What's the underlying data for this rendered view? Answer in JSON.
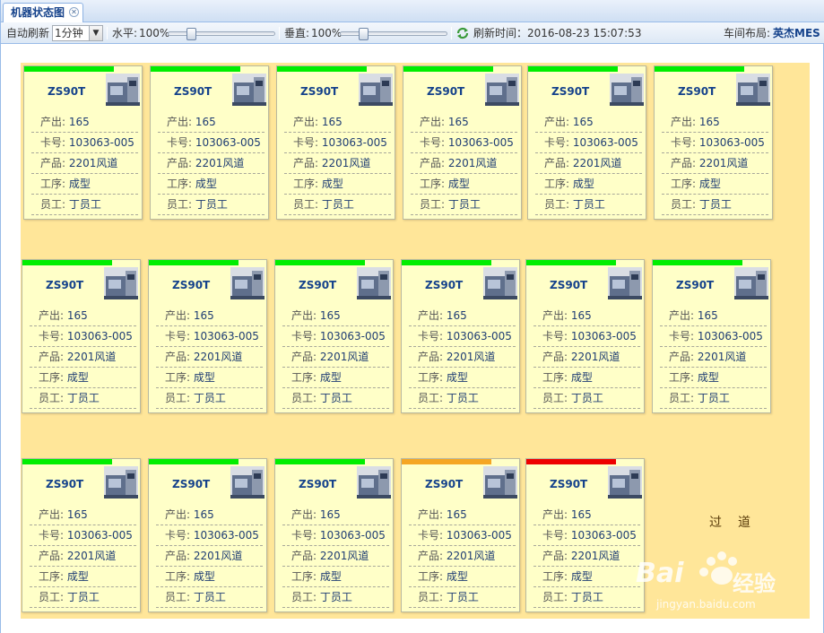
{
  "tab": {
    "title": "机器状态图"
  },
  "toolbar": {
    "auto_refresh_label": "自动刷新",
    "auto_refresh_value": "1分钟",
    "horizontal_label": "水平:",
    "horizontal_value": "100%",
    "vertical_label": "垂直:",
    "vertical_value": "100%",
    "refresh_time_label": "刷新时间：",
    "refresh_time_value": "2016-08-23 15:07:53",
    "layout_label": "车间布局:",
    "layout_value": "英杰MES"
  },
  "field_labels": {
    "output": "产出:",
    "card_no": "卡号:",
    "product": "产品:",
    "process": "工序:",
    "worker": "员工:"
  },
  "status_colors": {
    "running": "#00ee00",
    "warning": "#f5a623",
    "stopped": "#ee0000"
  },
  "machines": [
    {
      "name": "ZS90T",
      "status": "running",
      "output": "165",
      "card_no": "103063-005",
      "product": "2201风道",
      "process": "成型",
      "worker": "丁员工"
    },
    {
      "name": "ZS90T",
      "status": "running",
      "output": "165",
      "card_no": "103063-005",
      "product": "2201风道",
      "process": "成型",
      "worker": "丁员工"
    },
    {
      "name": "ZS90T",
      "status": "running",
      "output": "165",
      "card_no": "103063-005",
      "product": "2201风道",
      "process": "成型",
      "worker": "丁员工"
    },
    {
      "name": "ZS90T",
      "status": "running",
      "output": "165",
      "card_no": "103063-005",
      "product": "2201风道",
      "process": "成型",
      "worker": "丁员工"
    },
    {
      "name": "ZS90T",
      "status": "running",
      "output": "165",
      "card_no": "103063-005",
      "product": "2201风道",
      "process": "成型",
      "worker": "丁员工"
    },
    {
      "name": "ZS90T",
      "status": "running",
      "output": "165",
      "card_no": "103063-005",
      "product": "2201风道",
      "process": "成型",
      "worker": "丁员工"
    },
    {
      "name": "ZS90T",
      "status": "running",
      "output": "165",
      "card_no": "103063-005",
      "product": "2201风道",
      "process": "成型",
      "worker": "丁员工"
    },
    {
      "name": "ZS90T",
      "status": "running",
      "output": "165",
      "card_no": "103063-005",
      "product": "2201风道",
      "process": "成型",
      "worker": "丁员工"
    },
    {
      "name": "ZS90T",
      "status": "running",
      "output": "165",
      "card_no": "103063-005",
      "product": "2201风道",
      "process": "成型",
      "worker": "丁员工"
    },
    {
      "name": "ZS90T",
      "status": "running",
      "output": "165",
      "card_no": "103063-005",
      "product": "2201风道",
      "process": "成型",
      "worker": "丁员工"
    },
    {
      "name": "ZS90T",
      "status": "running",
      "output": "165",
      "card_no": "103063-005",
      "product": "2201风道",
      "process": "成型",
      "worker": "丁员工"
    },
    {
      "name": "ZS90T",
      "status": "running",
      "output": "165",
      "card_no": "103063-005",
      "product": "2201风道",
      "process": "成型",
      "worker": "丁员工"
    },
    {
      "name": "ZS90T",
      "status": "running",
      "output": "165",
      "card_no": "103063-005",
      "product": "2201风道",
      "process": "成型",
      "worker": "丁员工"
    },
    {
      "name": "ZS90T",
      "status": "running",
      "output": "165",
      "card_no": "103063-005",
      "product": "2201风道",
      "process": "成型",
      "worker": "丁员工"
    },
    {
      "name": "ZS90T",
      "status": "running",
      "output": "165",
      "card_no": "103063-005",
      "product": "2201风道",
      "process": "成型",
      "worker": "丁员工"
    },
    {
      "name": "ZS90T",
      "status": "warning",
      "output": "165",
      "card_no": "103063-005",
      "product": "2201风道",
      "process": "成型",
      "worker": "丁员工"
    },
    {
      "name": "ZS90T",
      "status": "stopped",
      "output": "165",
      "card_no": "103063-005",
      "product": "2201风道",
      "process": "成型",
      "worker": "丁员工"
    }
  ],
  "aisle": {
    "label": "过道"
  },
  "watermark": {
    "brand": "Bai",
    "brand_cn": "经验",
    "url": "jingyan.baidu.com"
  }
}
